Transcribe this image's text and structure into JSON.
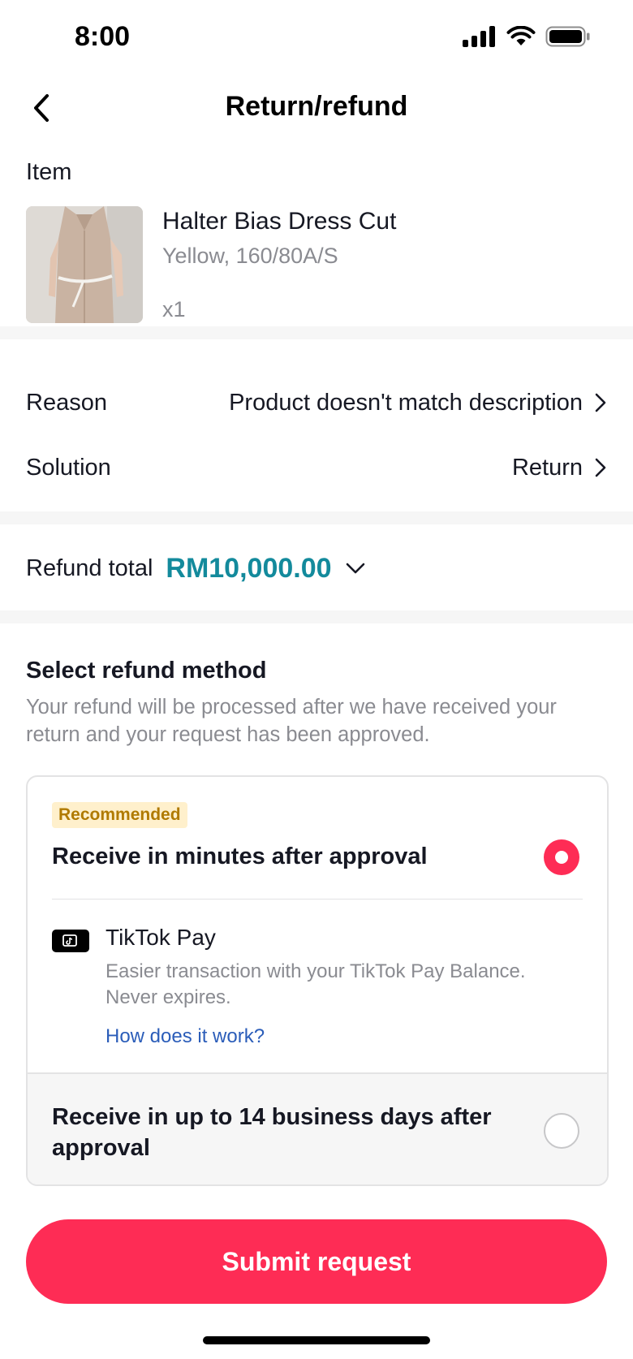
{
  "status_bar": {
    "time": "8:00"
  },
  "nav": {
    "title": "Return/refund"
  },
  "item_section": {
    "label": "Item",
    "product": {
      "name": "Halter Bias Dress Cut",
      "variant": "Yellow, 160/80A/S",
      "quantity": "x1"
    }
  },
  "reason": {
    "label": "Reason",
    "value": "Product doesn't match description"
  },
  "solution": {
    "label": "Solution",
    "value": "Return"
  },
  "refund_total": {
    "label": "Refund total",
    "amount": "RM10,000.00"
  },
  "refund_method": {
    "title": "Select refund method",
    "description": "Your refund will be processed after we have received your return and your request has been approved.",
    "options": [
      {
        "badge": "Recommended",
        "title": "Receive in minutes after approval",
        "selected": true,
        "payment_name": "TikTok Pay",
        "payment_description": "Easier transaction with your TikTok Pay Balance. Never expires.",
        "link": "How does it work?"
      },
      {
        "title": "Receive in up to 14 business days after approval",
        "selected": false
      }
    ]
  },
  "submit": {
    "label": "Submit request"
  },
  "colors": {
    "accent": "#fe2c55",
    "amount": "#138a9c",
    "link": "#2b5db9",
    "badge_bg": "#fff0cc",
    "badge_text": "#b07a00"
  },
  "icons": [
    "back-arrow-icon",
    "signal-icon",
    "wifi-icon",
    "battery-icon",
    "chevron-right-icon",
    "chevron-down-icon",
    "tiktok-pay-icon"
  ]
}
